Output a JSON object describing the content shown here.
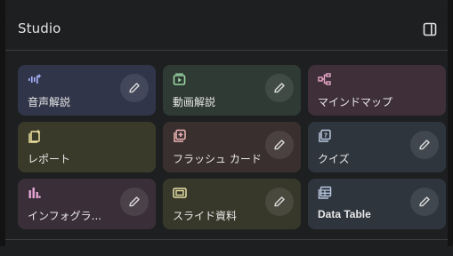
{
  "header": {
    "title": "Studio",
    "toggle_icon": "side-panel-icon"
  },
  "tiles": [
    {
      "label": "音声解説",
      "icon": "audio-waveform-icon",
      "accent": "#a8b4ff",
      "bg": "#31354a",
      "edit": true
    },
    {
      "label": "動画解説",
      "icon": "video-play-icon",
      "accent": "#9ad6a3",
      "bg": "#2e3a33",
      "edit": true
    },
    {
      "label": "マインドマップ",
      "icon": "mind-map-icon",
      "accent": "#e7a6c7",
      "bg": "#3e2f38",
      "edit": false
    },
    {
      "label": "レポート",
      "icon": "report-icon",
      "accent": "#f0e1a0",
      "bg": "#3a3a2a",
      "edit": false
    },
    {
      "label": "フラッシュ カード",
      "icon": "flashcard-icon",
      "accent": "#f0b6b6",
      "bg": "#3a2f2f",
      "edit": true
    },
    {
      "label": "クイズ",
      "icon": "quiz-icon",
      "accent": "#b9c8e0",
      "bg": "#2f353d",
      "edit": true
    },
    {
      "label": "インフォグラ...",
      "icon": "infographic-icon",
      "accent": "#e7a6d6",
      "bg": "#3a2f38",
      "edit": true
    },
    {
      "label": "スライド資料",
      "icon": "slides-icon",
      "accent": "#e7e0a6",
      "bg": "#37382a",
      "edit": true
    },
    {
      "label": "Data Table",
      "icon": "table-icon",
      "accent": "#b9c8e0",
      "bg": "#2f353d",
      "edit": true
    }
  ],
  "edit_icon": "pencil-icon"
}
